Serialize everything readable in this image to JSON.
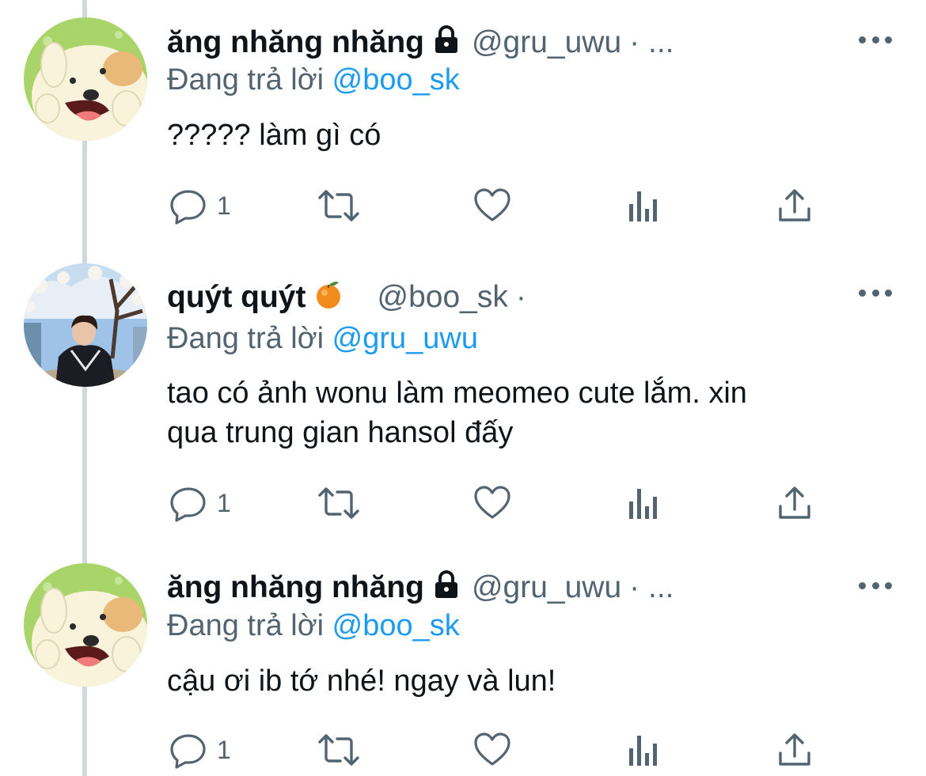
{
  "replying_prefix": "Đang trả lời",
  "tweets": [
    {
      "name": "ăng nhăng nhăng",
      "badge": "lock-icon",
      "handle": "@gru_uwu",
      "separator": "· ...",
      "reply_to": "@boo_sk",
      "text_lines": [
        "????? làm gì có"
      ],
      "reply_count": "1"
    },
    {
      "name": "quýt quýt",
      "badge": "tangerine-emoji",
      "handle": "@boo_sk",
      "separator": "·",
      "reply_to": "@gru_uwu",
      "text_lines": [
        "tao có ảnh wonu làm meomeo cute lắm. xin",
        "qua trung gian hansol đấy"
      ],
      "reply_count": "1"
    },
    {
      "name": "ăng nhăng nhăng",
      "badge": "lock-icon",
      "handle": "@gru_uwu",
      "separator": "· ...",
      "reply_to": "@boo_sk",
      "text_lines": [
        "cậu ơi ib tớ nhé! ngay và lun!"
      ],
      "reply_count": "1"
    }
  ],
  "colors": {
    "text": "#0f1419",
    "secondary": "#536471",
    "link": "#1d9bf0",
    "thread_line": "#cfd9de"
  },
  "icons": [
    "reply-icon",
    "retweet-icon",
    "like-icon",
    "analytics-icon",
    "share-icon",
    "more-icon"
  ]
}
